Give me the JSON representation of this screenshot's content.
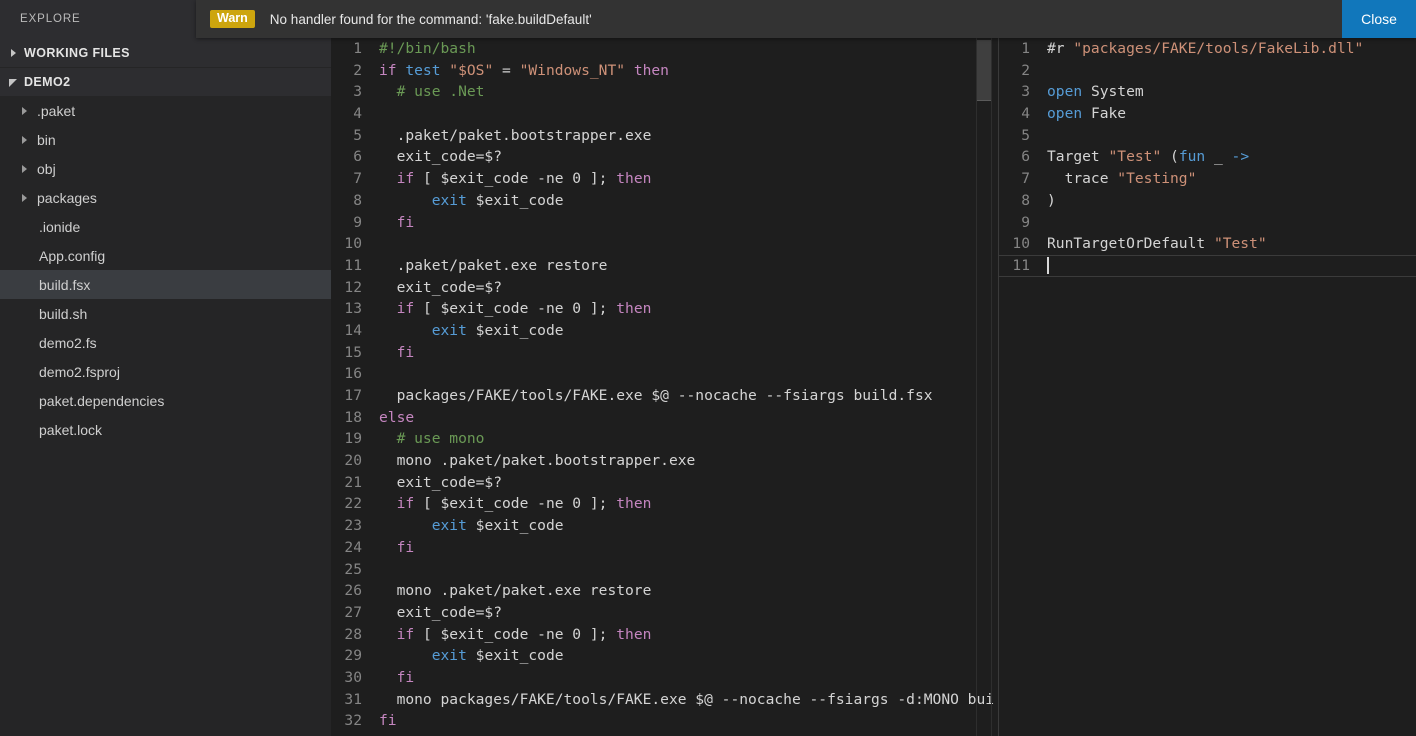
{
  "sidebar": {
    "explore_label": "EXPLORE",
    "sections": [
      {
        "label": "WORKING FILES",
        "state": "collapsed"
      },
      {
        "label": "DEMO2",
        "state": "expanded"
      }
    ],
    "folders": [
      {
        "label": ".paket"
      },
      {
        "label": "bin"
      },
      {
        "label": "obj"
      },
      {
        "label": "packages"
      }
    ],
    "files": [
      {
        "label": ".ionide",
        "selected": false
      },
      {
        "label": "App.config",
        "selected": false
      },
      {
        "label": "build.fsx",
        "selected": true
      },
      {
        "label": "build.sh",
        "selected": false
      },
      {
        "label": "demo2.fs",
        "selected": false
      },
      {
        "label": "demo2.fsproj",
        "selected": false
      },
      {
        "label": "paket.dependencies",
        "selected": false
      },
      {
        "label": "paket.lock",
        "selected": false
      }
    ]
  },
  "notification": {
    "severity_label": "Warn",
    "message": "No handler found for the command: 'fake.buildDefault'",
    "close_label": "Close",
    "badge_color": "#cda50e",
    "close_color": "#1177bb"
  },
  "editor_left": {
    "language": "shellscript",
    "first_line": 1,
    "lines": [
      {
        "n": 1,
        "tokens": [
          {
            "t": "#!/bin/bash",
            "c": "t-com"
          }
        ]
      },
      {
        "n": 2,
        "tokens": [
          {
            "t": "if ",
            "c": "t-kw"
          },
          {
            "t": "test ",
            "c": "t-fn"
          },
          {
            "t": "\"$OS\"",
            "c": "t-str"
          },
          {
            "t": " = ",
            "c": "t-plain"
          },
          {
            "t": "\"Windows_NT\"",
            "c": "t-str"
          },
          {
            "t": " ",
            "c": "t-plain"
          },
          {
            "t": "then",
            "c": "t-kw"
          }
        ]
      },
      {
        "n": 3,
        "tokens": [
          {
            "t": "  # use .Net",
            "c": "t-com"
          }
        ]
      },
      {
        "n": 4,
        "tokens": [
          {
            "t": "",
            "c": "t-plain"
          }
        ]
      },
      {
        "n": 5,
        "tokens": [
          {
            "t": "  .paket/paket.bootstrapper.exe",
            "c": "t-plain"
          }
        ]
      },
      {
        "n": 6,
        "tokens": [
          {
            "t": "  exit_code=$?",
            "c": "t-plain"
          }
        ]
      },
      {
        "n": 7,
        "tokens": [
          {
            "t": "  ",
            "c": "t-plain"
          },
          {
            "t": "if",
            "c": "t-kw"
          },
          {
            "t": " [ $exit_code -ne 0 ]; ",
            "c": "t-plain"
          },
          {
            "t": "then",
            "c": "t-kw"
          }
        ]
      },
      {
        "n": 8,
        "tokens": [
          {
            "t": "      ",
            "c": "t-plain"
          },
          {
            "t": "exit",
            "c": "t-fn"
          },
          {
            "t": " $exit_code",
            "c": "t-plain"
          }
        ]
      },
      {
        "n": 9,
        "tokens": [
          {
            "t": "  ",
            "c": "t-plain"
          },
          {
            "t": "fi",
            "c": "t-kw"
          }
        ]
      },
      {
        "n": 10,
        "tokens": [
          {
            "t": "",
            "c": "t-plain"
          }
        ]
      },
      {
        "n": 11,
        "tokens": [
          {
            "t": "  .paket/paket.exe restore",
            "c": "t-plain"
          }
        ]
      },
      {
        "n": 12,
        "tokens": [
          {
            "t": "  exit_code=$?",
            "c": "t-plain"
          }
        ]
      },
      {
        "n": 13,
        "tokens": [
          {
            "t": "  ",
            "c": "t-plain"
          },
          {
            "t": "if",
            "c": "t-kw"
          },
          {
            "t": " [ $exit_code -ne 0 ]; ",
            "c": "t-plain"
          },
          {
            "t": "then",
            "c": "t-kw"
          }
        ]
      },
      {
        "n": 14,
        "tokens": [
          {
            "t": "      ",
            "c": "t-plain"
          },
          {
            "t": "exit",
            "c": "t-fn"
          },
          {
            "t": " $exit_code",
            "c": "t-plain"
          }
        ]
      },
      {
        "n": 15,
        "tokens": [
          {
            "t": "  ",
            "c": "t-plain"
          },
          {
            "t": "fi",
            "c": "t-kw"
          }
        ]
      },
      {
        "n": 16,
        "tokens": [
          {
            "t": "",
            "c": "t-plain"
          }
        ]
      },
      {
        "n": 17,
        "tokens": [
          {
            "t": "  packages/FAKE/tools/FAKE.exe $@ --nocache --fsiargs build.fsx",
            "c": "t-plain"
          }
        ]
      },
      {
        "n": 18,
        "tokens": [
          {
            "t": "else",
            "c": "t-kw"
          }
        ]
      },
      {
        "n": 19,
        "tokens": [
          {
            "t": "  # use mono",
            "c": "t-com"
          }
        ]
      },
      {
        "n": 20,
        "tokens": [
          {
            "t": "  mono .paket/paket.bootstrapper.exe",
            "c": "t-plain"
          }
        ]
      },
      {
        "n": 21,
        "tokens": [
          {
            "t": "  exit_code=$?",
            "c": "t-plain"
          }
        ]
      },
      {
        "n": 22,
        "tokens": [
          {
            "t": "  ",
            "c": "t-plain"
          },
          {
            "t": "if",
            "c": "t-kw"
          },
          {
            "t": " [ $exit_code -ne 0 ]; ",
            "c": "t-plain"
          },
          {
            "t": "then",
            "c": "t-kw"
          }
        ]
      },
      {
        "n": 23,
        "tokens": [
          {
            "t": "      ",
            "c": "t-plain"
          },
          {
            "t": "exit",
            "c": "t-fn"
          },
          {
            "t": " $exit_code",
            "c": "t-plain"
          }
        ]
      },
      {
        "n": 24,
        "tokens": [
          {
            "t": "  ",
            "c": "t-plain"
          },
          {
            "t": "fi",
            "c": "t-kw"
          }
        ]
      },
      {
        "n": 25,
        "tokens": [
          {
            "t": "",
            "c": "t-plain"
          }
        ]
      },
      {
        "n": 26,
        "tokens": [
          {
            "t": "  mono .paket/paket.exe restore",
            "c": "t-plain"
          }
        ]
      },
      {
        "n": 27,
        "tokens": [
          {
            "t": "  exit_code=$?",
            "c": "t-plain"
          }
        ]
      },
      {
        "n": 28,
        "tokens": [
          {
            "t": "  ",
            "c": "t-plain"
          },
          {
            "t": "if",
            "c": "t-kw"
          },
          {
            "t": " [ $exit_code -ne 0 ]; ",
            "c": "t-plain"
          },
          {
            "t": "then",
            "c": "t-kw"
          }
        ]
      },
      {
        "n": 29,
        "tokens": [
          {
            "t": "      ",
            "c": "t-plain"
          },
          {
            "t": "exit",
            "c": "t-fn"
          },
          {
            "t": " $exit_code",
            "c": "t-plain"
          }
        ]
      },
      {
        "n": 30,
        "tokens": [
          {
            "t": "  ",
            "c": "t-plain"
          },
          {
            "t": "fi",
            "c": "t-kw"
          }
        ]
      },
      {
        "n": 31,
        "tokens": [
          {
            "t": "  mono packages/FAKE/tools/FAKE.exe $@ --nocache --fsiargs -d:MONO bui",
            "c": "t-plain"
          }
        ]
      },
      {
        "n": 32,
        "tokens": [
          {
            "t": "fi",
            "c": "t-kw"
          }
        ]
      }
    ]
  },
  "editor_right": {
    "language": "fsharp",
    "first_line": 1,
    "cursor_line": 11,
    "lines": [
      {
        "n": 1,
        "tokens": [
          {
            "t": "#r ",
            "c": "t-plain"
          },
          {
            "t": "\"packages/FAKE/tools/FakeLib.dll\"",
            "c": "t-str"
          }
        ]
      },
      {
        "n": 2,
        "tokens": [
          {
            "t": "",
            "c": "t-plain"
          }
        ]
      },
      {
        "n": 3,
        "tokens": [
          {
            "t": "open",
            "c": "t-fn"
          },
          {
            "t": " System",
            "c": "t-plain"
          }
        ]
      },
      {
        "n": 4,
        "tokens": [
          {
            "t": "open",
            "c": "t-fn"
          },
          {
            "t": " Fake",
            "c": "t-plain"
          }
        ]
      },
      {
        "n": 5,
        "tokens": [
          {
            "t": "",
            "c": "t-plain"
          }
        ]
      },
      {
        "n": 6,
        "tokens": [
          {
            "t": "Target ",
            "c": "t-plain"
          },
          {
            "t": "\"Test\"",
            "c": "t-str"
          },
          {
            "t": " (",
            "c": "t-plain"
          },
          {
            "t": "fun",
            "c": "t-fn"
          },
          {
            "t": " _ ",
            "c": "t-plain"
          },
          {
            "t": "->",
            "c": "t-fn"
          }
        ]
      },
      {
        "n": 7,
        "tokens": [
          {
            "t": "  trace ",
            "c": "t-plain"
          },
          {
            "t": "\"Testing\"",
            "c": "t-str"
          }
        ]
      },
      {
        "n": 8,
        "tokens": [
          {
            "t": ")",
            "c": "t-plain"
          }
        ]
      },
      {
        "n": 9,
        "tokens": [
          {
            "t": "",
            "c": "t-plain"
          }
        ]
      },
      {
        "n": 10,
        "tokens": [
          {
            "t": "RunTargetOrDefault ",
            "c": "t-plain"
          },
          {
            "t": "\"Test\"",
            "c": "t-str"
          }
        ]
      },
      {
        "n": 11,
        "tokens": [
          {
            "t": "",
            "c": "t-plain"
          }
        ]
      }
    ]
  },
  "theme": {
    "sidebar_bg": "#252526",
    "editor_bg": "#1e1e1e",
    "selected_row_bg": "#3a3d41",
    "keyword": "#c586c0",
    "function": "#569cd6",
    "string": "#ce9178",
    "comment": "#6a9955",
    "text": "#d4d4d4",
    "lineno": "#858585"
  }
}
